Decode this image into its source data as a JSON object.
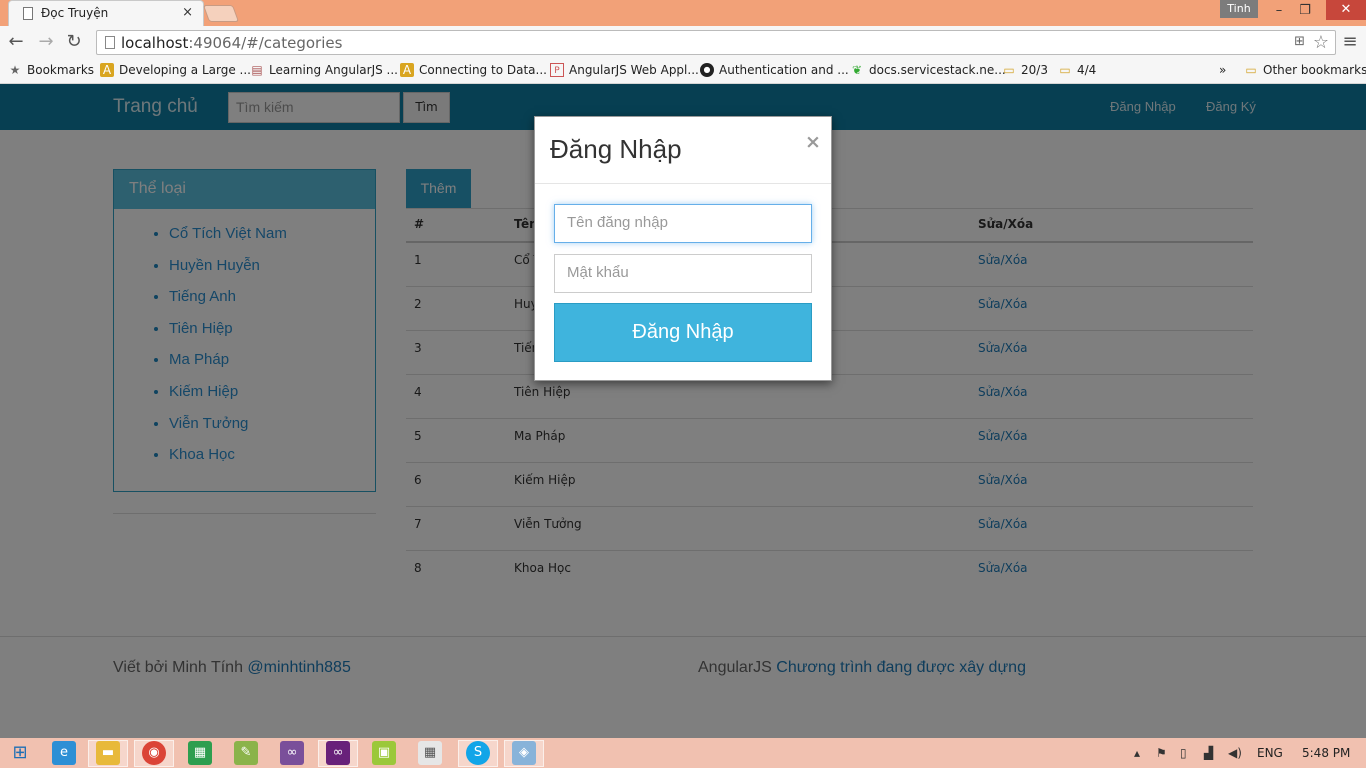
{
  "browser": {
    "tab_title": "Đọc Truyện",
    "tab_close": "×",
    "user_badge": "Tinh",
    "minimize": "–",
    "restore": "❐",
    "close": "✕",
    "url_host": "localhost",
    "url_rest": ":49064/#/categories",
    "bookmarks": [
      {
        "label": "Bookmarks",
        "icon": "star-icon"
      },
      {
        "label": "Developing a Large ...",
        "icon": "angular-icon"
      },
      {
        "label": "Learning AngularJS ...",
        "icon": "book-icon"
      },
      {
        "label": "Connecting to Data...",
        "icon": "angular-icon"
      },
      {
        "label": "AngularJS Web Appl...",
        "icon": "page-icon"
      },
      {
        "label": "Authentication and ...",
        "icon": "github-icon"
      },
      {
        "label": "docs.servicestack.ne...",
        "icon": "leaf-icon"
      },
      {
        "label": "20/3",
        "icon": "folder-icon"
      },
      {
        "label": "4/4",
        "icon": "folder-icon"
      },
      {
        "label": "»",
        "icon": ""
      },
      {
        "label": "Other bookmarks",
        "icon": "folder-icon"
      }
    ]
  },
  "navbar": {
    "brand": "Trang chủ",
    "search_placeholder": "Tìm kiếm",
    "search_button": "Tìm",
    "login": "Đăng Nhập",
    "register": "Đăng Ký"
  },
  "sidebar": {
    "heading": "Thể loại",
    "items": [
      "Cổ Tích Việt Nam",
      "Huyền Huyễn",
      "Tiếng Anh",
      "Tiên Hiệp",
      "Ma Pháp",
      "Kiếm Hiệp",
      "Viễn Tưởng",
      "Khoa Học"
    ]
  },
  "main": {
    "add_button": "Thêm",
    "headers": {
      "num": "#",
      "name": "Tên",
      "actions": "Sửa/Xóa"
    },
    "rows": [
      {
        "num": "1",
        "name": "Cổ Tích Việt Nam",
        "action": "Sửa/Xóa"
      },
      {
        "num": "2",
        "name": "Huyền Huyễn",
        "action": "Sửa/Xóa"
      },
      {
        "num": "3",
        "name": "Tiếng Anh",
        "action": "Sửa/Xóa"
      },
      {
        "num": "4",
        "name": "Tiên Hiệp",
        "action": "Sửa/Xóa"
      },
      {
        "num": "5",
        "name": "Ma Pháp",
        "action": "Sửa/Xóa"
      },
      {
        "num": "6",
        "name": "Kiếm Hiệp",
        "action": "Sửa/Xóa"
      },
      {
        "num": "7",
        "name": "Viễn Tưởng",
        "action": "Sửa/Xóa"
      },
      {
        "num": "8",
        "name": "Khoa Học",
        "action": "Sửa/Xóa"
      }
    ]
  },
  "footer": {
    "left_text": "Viết bởi Minh Tính ",
    "left_link": "@minhtinh885",
    "right_text": "AngularJS ",
    "right_link": "Chương trình đang được xây dựng"
  },
  "modal": {
    "title": "Đăng Nhập",
    "close": "×",
    "username_placeholder": "Tên đăng nhập",
    "password_placeholder": "Mật khẩu",
    "submit": "Đăng Nhập"
  },
  "taskbar": {
    "lang": "ENG",
    "time": "5:48 PM"
  },
  "colors": {
    "navbar": "#0e7fa5",
    "primary": "#3fb4dd",
    "link": "#1d7ab8"
  }
}
